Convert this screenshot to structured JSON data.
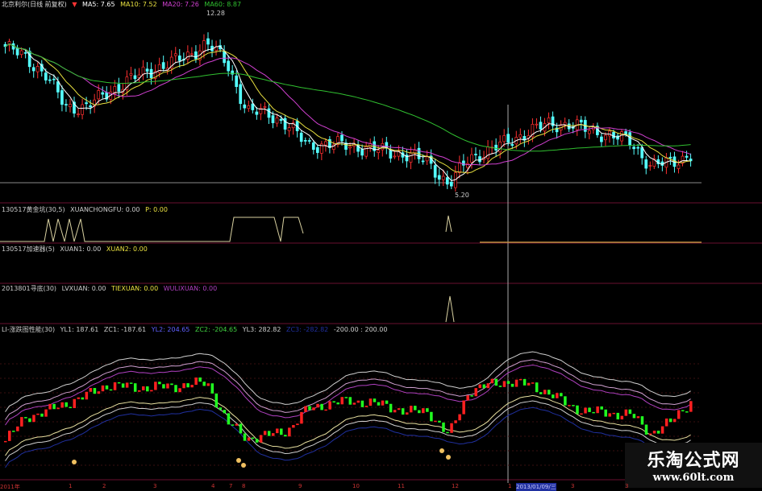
{
  "header": {
    "title": "北京利尔(日线 前复权)",
    "ma5": "MA5: 7.65",
    "ma10": "MA10: 7.52",
    "ma20": "MA20: 7.26",
    "ma60": "MA60: 8.87"
  },
  "panels": {
    "p2": {
      "title": "130517黄金坑(30,5)",
      "v1": "XUANCHONGFU: 0.00",
      "v2": "P: 0.00"
    },
    "p3": {
      "title": "130517加速器(5)",
      "v1": "XUAN1: 0.00",
      "v2": "XUAN2: 0.00"
    },
    "p4": {
      "title": "2013801寻底(30)",
      "v1": "LVXUAN: 0.00",
      "v2": "TIEXUAN: 0.00",
      "v3": "WULIXUAN: 0.00"
    },
    "p5": {
      "title": "LI-涨跌图性能(30)",
      "v1": "YL1: 187.61",
      "v2": "ZC1: -187.61",
      "v3": "YL2: 204.65",
      "v4": "ZC2: -204.65",
      "v5": "YL3: 282.82",
      "v6": "ZC3: -282.82",
      "v7": "-200.00 : 200.00"
    }
  },
  "chart_data": {
    "type": "candlestick",
    "high_label": "12.28",
    "low_label": "5.20",
    "key_closes": [
      11.8,
      11.3,
      10.5,
      9.0,
      9.0,
      9.6,
      10.2,
      10.6,
      11.0,
      11.3,
      12.0,
      11.0,
      8.8,
      8.7,
      8.2,
      7.2,
      7.3,
      7.2,
      7.1,
      6.9,
      6.8,
      6.4,
      5.4,
      6.6,
      7.0,
      7.4,
      7.9,
      8.2,
      8.2,
      7.9,
      7.7,
      7.4,
      6.3,
      6.4,
      6.8
    ],
    "indicator": [
      -130,
      -40,
      -20,
      10,
      40,
      80,
      75,
      70,
      75,
      80,
      90,
      -60,
      -120,
      -110,
      -90,
      -10,
      10,
      20,
      15,
      0,
      -20,
      -20,
      -110,
      60,
      80,
      95,
      80,
      50,
      0,
      -20,
      -25,
      -30,
      -100,
      -60,
      20
    ],
    "indicator_range": [
      -200,
      200
    ],
    "colors": {
      "up": "#ff3030",
      "down": "#54ffff",
      "ma5": "#ffffff",
      "ma10": "#e8e040",
      "ma20": "#d040d0",
      "ma60": "#30c030",
      "ind_up": "#ff2020",
      "ind_down": "#20ff20"
    }
  },
  "x_axis": [
    "2011年",
    "1",
    "2",
    "3",
    "4",
    "7",
    "8",
    "9",
    "10",
    "11",
    "12",
    "1",
    "2013/01/09/三",
    "3",
    "3"
  ],
  "watermark": {
    "name": "乐淘公式网",
    "url": "www.60lt.com"
  }
}
